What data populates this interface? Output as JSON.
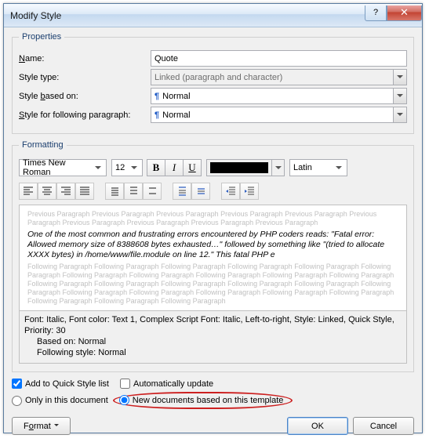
{
  "window": {
    "title": "Modify Style",
    "help": "?",
    "close": "✕"
  },
  "properties": {
    "legend": "Properties",
    "name_label": "Name:",
    "name_value": "Quote",
    "type_label": "Style type:",
    "type_value": "Linked (paragraph and character)",
    "based_label": "Style based on:",
    "based_value": "Normal",
    "following_label": "Style for following paragraph:",
    "following_value": "Normal"
  },
  "formatting": {
    "legend": "Formatting",
    "font": "Times New Roman",
    "size": "12",
    "bold": "B",
    "italic": "I",
    "underline": "U",
    "script": "Latin",
    "preview_grey": "Previous Paragraph Previous Paragraph Previous Paragraph Previous Paragraph Previous Paragraph Previous Paragraph Previous Paragraph Previous Paragraph Previous Paragraph Previous Paragraph",
    "preview_body": "One of the most common and frustrating errors encountered by PHP coders reads: \"Fatal error: Allowed memory size of 8388608 bytes exhausted…\" followed by something like \"(tried to allocate XXXX bytes) in /home/www/file.module on line 12.\" This fatal PHP e",
    "preview_follow": "Following Paragraph Following Paragraph Following Paragraph Following Paragraph Following Paragraph Following Paragraph Following Paragraph Following Paragraph Following Paragraph Following Paragraph Following Paragraph Following Paragraph Following Paragraph Following Paragraph Following Paragraph Following Paragraph Following Paragraph Following Paragraph Following Paragraph Following Paragraph Following Paragraph Following Paragraph Following Paragraph Following Paragraph Following Paragraph",
    "desc_line1": "Font: Italic, Font color: Text 1, Complex Script Font: Italic, Left-to-right, Style: Linked, Quick Style, Priority: 30",
    "desc_line2": "Based on: Normal",
    "desc_line3": "Following style: Normal"
  },
  "options": {
    "quick_style": "Add to Quick Style list",
    "auto_update": "Automatically update",
    "only_doc": "Only in this document",
    "new_docs": "New documents based on this template"
  },
  "footer": {
    "format": "Format",
    "ok": "OK",
    "cancel": "Cancel"
  }
}
